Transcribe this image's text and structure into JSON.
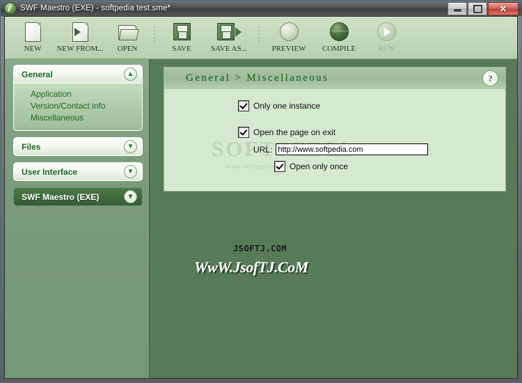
{
  "window": {
    "title": "SWF Maestro (EXE) - softpedia test.sme*",
    "app_icon": "swf-maestro-icon",
    "controls": {
      "minimize": "minimize-icon",
      "maximize": "maximize-icon",
      "close": "✕"
    },
    "colors": {
      "sidebar_green": "#7b9d7d",
      "canvas_green": "#567b56",
      "panel_bg": "#d5e8d0",
      "accent_text_green": "#1f6b26",
      "title_green": "#0f5d17"
    }
  },
  "toolbar": {
    "items": [
      {
        "label": "NEW",
        "icon": "new-document-icon",
        "disabled": false
      },
      {
        "label": "NEW FROM...",
        "icon": "new-from-template-icon",
        "disabled": false
      },
      {
        "label": "OPEN",
        "icon": "open-folder-icon",
        "disabled": false
      },
      {
        "label": "SAVE",
        "icon": "save-floppy-icon",
        "disabled": false
      },
      {
        "label": "SAVE AS...",
        "icon": "save-as-floppy-icon",
        "disabled": false
      },
      {
        "label": "PREVIEW",
        "icon": "preview-sphere-icon",
        "disabled": false
      },
      {
        "label": "COMPILE",
        "icon": "compile-sphere-icon",
        "disabled": false
      },
      {
        "label": "RUN",
        "icon": "run-play-icon",
        "disabled": true
      }
    ]
  },
  "sidebar": {
    "groups": [
      {
        "label": "General",
        "state": "expanded",
        "chevron": "chevron-up-icon",
        "items": [
          {
            "label": "Application"
          },
          {
            "label": "Version/Contact info"
          },
          {
            "label": "Miscellaneous"
          }
        ]
      },
      {
        "label": "Files",
        "state": "collapsed",
        "chevron": "chevron-down-icon",
        "items": []
      },
      {
        "label": "User Interface",
        "state": "collapsed",
        "chevron": "chevron-down-icon",
        "items": []
      },
      {
        "label": "SWF Maestro (EXE)",
        "state": "collapsed-selected",
        "chevron": "chevron-down-icon",
        "items": []
      }
    ]
  },
  "panel": {
    "title": "General > Miscellaneous",
    "help_icon": "?",
    "watermark": {
      "brand": "SOFTPEDIA",
      "trademark": "TM",
      "url": "www.softpedia.com"
    },
    "fields": {
      "only_one_instance": {
        "label": "Only one instance",
        "checked": true
      },
      "open_page_on_exit": {
        "label": "Open the page on exit",
        "checked": true
      },
      "url": {
        "label": "URL:",
        "value": "http://www.softpedia.com",
        "placeholder": "http://"
      },
      "open_only_once": {
        "label": "Open only once",
        "checked": true
      }
    }
  },
  "overlay_watermarks": {
    "small": "JSOFTJ.COM",
    "large": "WwW.JsofTJ.CoM"
  }
}
